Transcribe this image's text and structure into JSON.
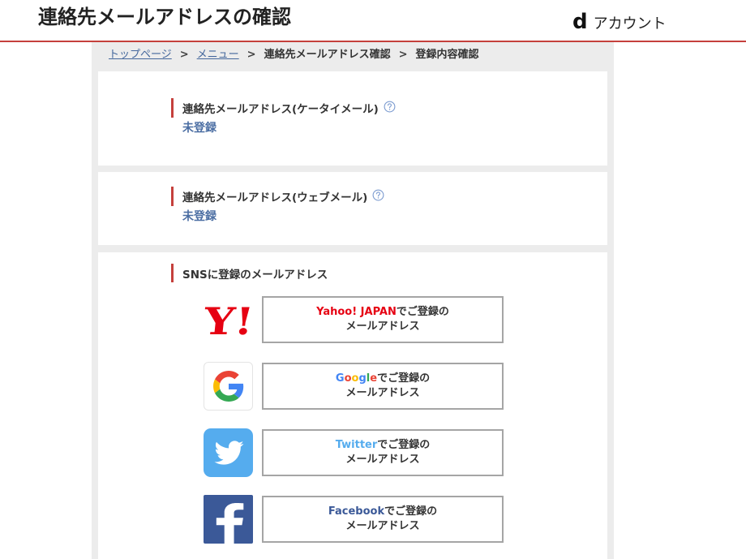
{
  "header": {
    "title": "連絡先メールアドレスの確認",
    "logo_mark": "d",
    "logo_text": "アカウント"
  },
  "colors": {
    "accent": "#c5403c",
    "panel_background": "#ececec",
    "link": "#44679c",
    "status": "#4b6ea3",
    "help_icon": "#7d9cd0",
    "button_border": "#a5a5a5"
  },
  "breadcrumb": {
    "separator": ">",
    "items": [
      {
        "label": "トップページ"
      },
      {
        "label": "メニュー"
      },
      {
        "label": "連絡先メールアドレス確認"
      },
      {
        "label": "登録内容確認"
      }
    ]
  },
  "contact_sections": [
    {
      "title": "連絡先メールアドレス(ケータイメール)",
      "help_icon": "help-circle-icon",
      "status": "未登録"
    },
    {
      "title": "連絡先メールアドレス(ウェブメール)",
      "help_icon": "help-circle-icon",
      "status": "未登録"
    }
  ],
  "sns_section": {
    "title": "SNSに登録のメールアドレス",
    "buttons": [
      {
        "icon": "yahoo-japan-logo-icon",
        "logo_text": "Y!",
        "logo_color": "#e60012",
        "brand": "Yahoo! JAPAN",
        "brand_color": "#e60012",
        "suffix": "でご登録の",
        "line2": "メールアドレス"
      },
      {
        "icon": "google-logo-icon",
        "logo_text": "G",
        "brand": "Google",
        "brand_letter_colors": [
          "#4285f4",
          "#ea4335",
          "#fbbc05",
          "#4285f4",
          "#34a853",
          "#ea4335"
        ],
        "suffix": "でご登録の",
        "line2": "メールアドレス"
      },
      {
        "icon": "twitter-bird-icon",
        "icon_background": "#55acee",
        "brand": "Twitter",
        "brand_color": "#55acee",
        "suffix": "でご登録の",
        "line2": "メールアドレス"
      },
      {
        "icon": "facebook-logo-icon",
        "logo_text": "f",
        "icon_background": "#3b5998",
        "brand": "Facebook",
        "brand_color": "#3b5998",
        "suffix": "でご登録の",
        "line2": "メールアドレス"
      }
    ]
  }
}
